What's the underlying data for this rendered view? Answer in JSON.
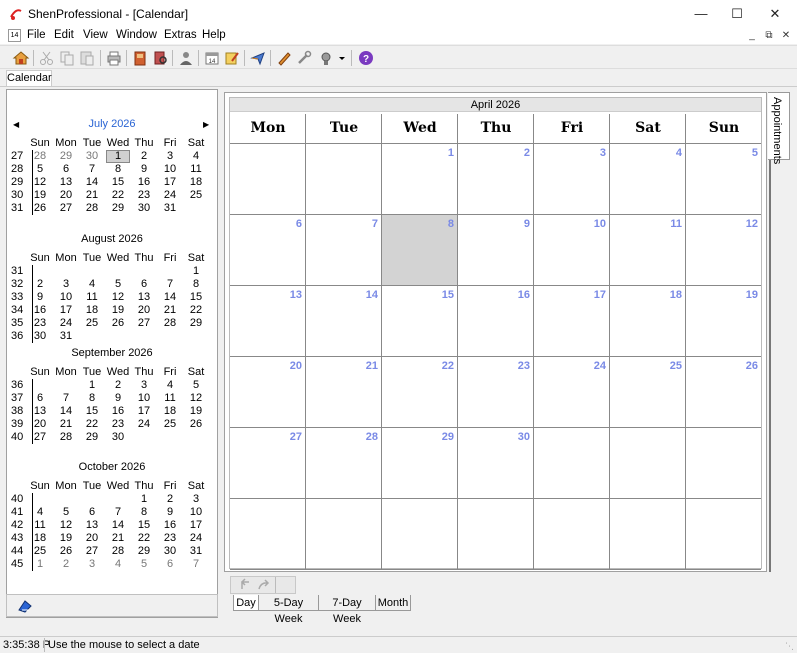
{
  "window": {
    "title": "ShenProfessional - [Calendar]",
    "controls": [
      "—",
      "☐",
      "✕"
    ]
  },
  "menu": {
    "items": [
      "File",
      "Edit",
      "View",
      "Window",
      "Extras",
      "Help"
    ],
    "icon_label": "14",
    "mdi": [
      "_",
      "⧉",
      "✕"
    ]
  },
  "toolbar": {
    "icons": [
      "home-icon",
      "cut-icon",
      "copy-icon",
      "paste-icon",
      "print-icon",
      "address-book-icon",
      "search-book-icon",
      "contacts-icon",
      "calendar-icon",
      "notes-icon",
      "send-icon",
      "edit-icon",
      "settings-icon",
      "tools-icon",
      "dropdown-icon",
      "help-icon"
    ]
  },
  "doc_tab": {
    "label": "Calendar"
  },
  "mini_calendars": [
    {
      "title": "July 2026",
      "current": true,
      "dow": [
        "Sun",
        "Mon",
        "Tue",
        "Wed",
        "Thu",
        "Fri",
        "Sat"
      ],
      "weeks": [
        {
          "wk": "27",
          "days": [
            "28",
            "29",
            "30",
            "1",
            "2",
            "3",
            "4"
          ],
          "dim": [
            0,
            1,
            2
          ],
          "today": 3
        },
        {
          "wk": "28",
          "days": [
            "5",
            "6",
            "7",
            "8",
            "9",
            "10",
            "11"
          ],
          "dim": [],
          "today": -1
        },
        {
          "wk": "29",
          "days": [
            "12",
            "13",
            "14",
            "15",
            "16",
            "17",
            "18"
          ],
          "dim": [],
          "today": -1
        },
        {
          "wk": "30",
          "days": [
            "19",
            "20",
            "21",
            "22",
            "23",
            "24",
            "25"
          ],
          "dim": [],
          "today": -1
        },
        {
          "wk": "31",
          "days": [
            "26",
            "27",
            "28",
            "29",
            "30",
            "31",
            ""
          ],
          "dim": [],
          "today": -1
        }
      ]
    },
    {
      "title": "August 2026",
      "current": false,
      "dow": [
        "Sun",
        "Mon",
        "Tue",
        "Wed",
        "Thu",
        "Fri",
        "Sat"
      ],
      "weeks": [
        {
          "wk": "31",
          "days": [
            "",
            "",
            "",
            "",
            "",
            "",
            "1"
          ],
          "dim": [],
          "today": -1
        },
        {
          "wk": "32",
          "days": [
            "2",
            "3",
            "4",
            "5",
            "6",
            "7",
            "8"
          ],
          "dim": [],
          "today": -1
        },
        {
          "wk": "33",
          "days": [
            "9",
            "10",
            "11",
            "12",
            "13",
            "14",
            "15"
          ],
          "dim": [],
          "today": -1
        },
        {
          "wk": "34",
          "days": [
            "16",
            "17",
            "18",
            "19",
            "20",
            "21",
            "22"
          ],
          "dim": [],
          "today": -1
        },
        {
          "wk": "35",
          "days": [
            "23",
            "24",
            "25",
            "26",
            "27",
            "28",
            "29"
          ],
          "dim": [],
          "today": -1
        },
        {
          "wk": "36",
          "days": [
            "30",
            "31",
            "",
            "",
            "",
            "",
            ""
          ],
          "dim": [],
          "today": -1
        }
      ]
    },
    {
      "title": "September 2026",
      "current": false,
      "dow": [
        "Sun",
        "Mon",
        "Tue",
        "Wed",
        "Thu",
        "Fri",
        "Sat"
      ],
      "weeks": [
        {
          "wk": "36",
          "days": [
            "",
            "",
            "1",
            "2",
            "3",
            "4",
            "5"
          ],
          "dim": [],
          "today": -1
        },
        {
          "wk": "37",
          "days": [
            "6",
            "7",
            "8",
            "9",
            "10",
            "11",
            "12"
          ],
          "dim": [],
          "today": -1
        },
        {
          "wk": "38",
          "days": [
            "13",
            "14",
            "15",
            "16",
            "17",
            "18",
            "19"
          ],
          "dim": [],
          "today": -1
        },
        {
          "wk": "39",
          "days": [
            "20",
            "21",
            "22",
            "23",
            "24",
            "25",
            "26"
          ],
          "dim": [],
          "today": -1
        },
        {
          "wk": "40",
          "days": [
            "27",
            "28",
            "29",
            "30",
            "",
            "",
            ""
          ],
          "dim": [],
          "today": -1
        }
      ]
    },
    {
      "title": "October 2026",
      "current": false,
      "dow": [
        "Sun",
        "Mon",
        "Tue",
        "Wed",
        "Thu",
        "Fri",
        "Sat"
      ],
      "weeks": [
        {
          "wk": "40",
          "days": [
            "",
            "",
            "",
            "",
            "1",
            "2",
            "3"
          ],
          "dim": [],
          "today": -1
        },
        {
          "wk": "41",
          "days": [
            "4",
            "5",
            "6",
            "7",
            "8",
            "9",
            "10"
          ],
          "dim": [],
          "today": -1
        },
        {
          "wk": "42",
          "days": [
            "11",
            "12",
            "13",
            "14",
            "15",
            "16",
            "17"
          ],
          "dim": [],
          "today": -1
        },
        {
          "wk": "43",
          "days": [
            "18",
            "19",
            "20",
            "21",
            "22",
            "23",
            "24"
          ],
          "dim": [],
          "today": -1
        },
        {
          "wk": "44",
          "days": [
            "25",
            "26",
            "27",
            "28",
            "29",
            "30",
            "31"
          ],
          "dim": [],
          "today": -1
        },
        {
          "wk": "45",
          "days": [
            "1",
            "2",
            "3",
            "4",
            "5",
            "6",
            "7"
          ],
          "dim": [
            0,
            1,
            2,
            3,
            4,
            5,
            6
          ],
          "today": -1
        }
      ]
    }
  ],
  "month_view": {
    "title": "April 2026",
    "day_headers": [
      "Mon",
      "Tue",
      "Wed",
      "Thu",
      "Fri",
      "Sat",
      "Sun"
    ],
    "weeks": [
      [
        "",
        "",
        "1",
        "2",
        "3",
        "4",
        "5"
      ],
      [
        "6",
        "7",
        "8",
        "9",
        "10",
        "11",
        "12"
      ],
      [
        "13",
        "14",
        "15",
        "16",
        "17",
        "18",
        "19"
      ],
      [
        "20",
        "21",
        "22",
        "23",
        "24",
        "25",
        "26"
      ],
      [
        "27",
        "28",
        "29",
        "30",
        "",
        "",
        ""
      ],
      [
        "",
        "",
        "",
        "",
        "",
        "",
        ""
      ]
    ],
    "selected": {
      "week": 1,
      "day": 2
    }
  },
  "side_tab": {
    "label": "Appointments"
  },
  "view_tabs": [
    "Day",
    "5-Day Week",
    "7-Day Week",
    "Month"
  ],
  "status": {
    "time": "3:35:38 P",
    "message": "Use the mouse to select a date"
  },
  "colors": {
    "date_number": "#7a8ae6",
    "current_month": "#2a64d4",
    "selected_cell": "#d3d3d3"
  }
}
